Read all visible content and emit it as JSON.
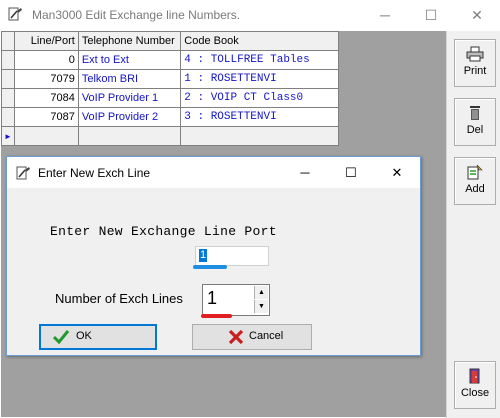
{
  "window": {
    "title": "Man3000 Edit Exchange line Numbers.",
    "minimize": "─",
    "maximize": "☐",
    "close": "✕"
  },
  "grid": {
    "headers": [
      "Line/Port",
      "Telephone Number",
      "Code Book"
    ],
    "rows": [
      {
        "port": "0",
        "telephone": "Ext to Ext",
        "code": "4 : TOLLFREE Tables"
      },
      {
        "port": "7079",
        "telephone": "Telkom BRI",
        "code": "1 : ROSETTENVI"
      },
      {
        "port": "7084",
        "telephone": "VoIP Provider 1",
        "code": "2 : VOIP CT Class0"
      },
      {
        "port": "7087",
        "telephone": "VoIP Provider 2",
        "code": "3 : ROSETTENVI"
      }
    ],
    "new_row_marker": "►"
  },
  "toolbar": {
    "print_label": "Print",
    "del_label": "Del",
    "add_label": "Add",
    "close_label": "Close"
  },
  "dialog": {
    "title": "Enter New Exch Line",
    "minimize": "─",
    "maximize": "☐",
    "close": "✕",
    "prompt": "Enter New Exchange Line Port",
    "port_value": "1",
    "count_label": "Number of Exch Lines",
    "count_value": "1",
    "ok_label": "OK",
    "cancel_label": "Cancel",
    "port_underline_color": "#1e8fe0",
    "count_underline_color": "#e02020"
  },
  "colors": {
    "client_bg": "#a0a0a0",
    "link_text": "#1414c8",
    "selection": "#0078d7"
  }
}
